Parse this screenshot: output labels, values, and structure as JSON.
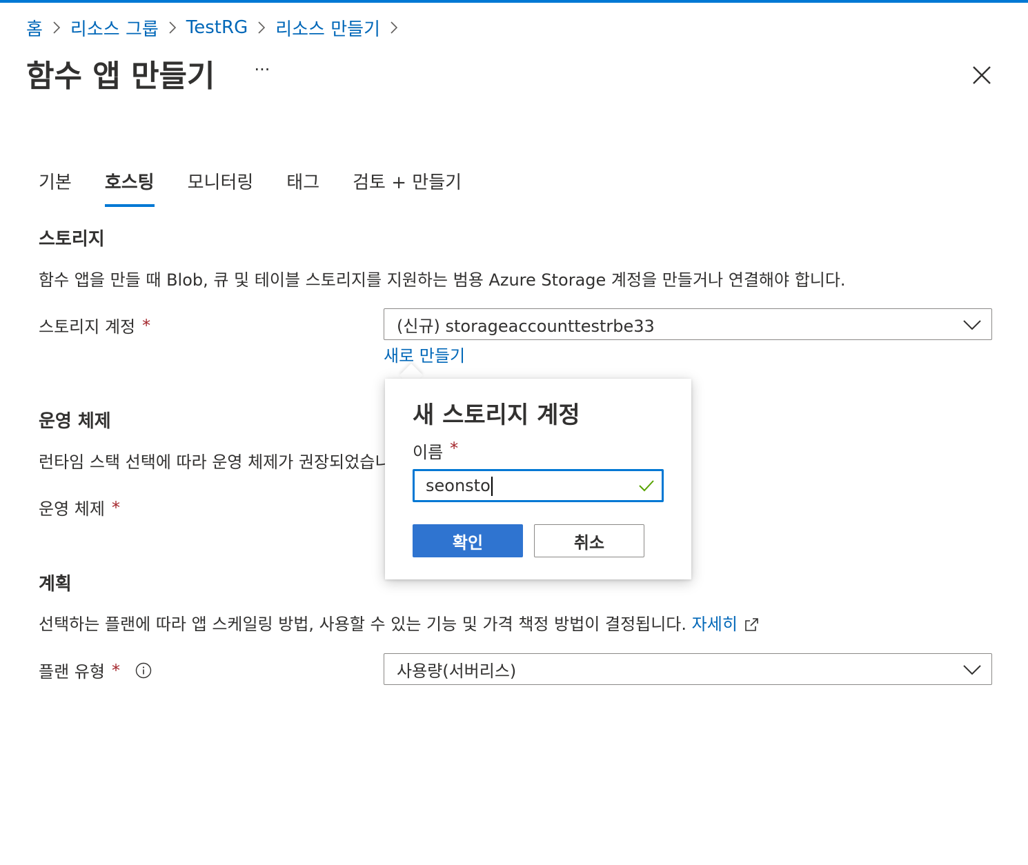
{
  "breadcrumb": {
    "items": [
      "홈",
      "리소스 그룹",
      "TestRG",
      "리소스 만들기"
    ]
  },
  "header": {
    "title": "함수 앱 만들기",
    "more_label": "···"
  },
  "tabs": [
    {
      "label": "기본",
      "active": false
    },
    {
      "label": "호스팅",
      "active": true
    },
    {
      "label": "모니터링",
      "active": false
    },
    {
      "label": "태그",
      "active": false
    },
    {
      "label": "검토 + 만들기",
      "active": false
    }
  ],
  "storage": {
    "title": "스토리지",
    "description": "함수 앱을 만들 때 Blob, 큐 및 테이블 스토리지를 지원하는 범용 Azure Storage 계정을 만들거나 연결해야 합니다.",
    "account_label": "스토리지 계정",
    "account_value": "(신규) storageaccounttestrbe33",
    "create_new_link": "새로 만들기"
  },
  "os": {
    "title": "운영 체제",
    "description": "런타임 스택 선택에 따라 운영 체제가 권장되었습니",
    "label": "운영 체제"
  },
  "plan": {
    "title": "계획",
    "description": "선택하는 플랜에 따라 앱 스케일링 방법, 사용할 수 있는 기능 및 가격 책정 방법이 결정됩니다.",
    "learn_more": "자세히",
    "type_label": "플랜 유형",
    "type_value": "사용량(서버리스)"
  },
  "required_mark": "*",
  "popup": {
    "title": "새 스토리지 계정",
    "name_label": "이름",
    "name_value": "seonsto",
    "ok_label": "확인",
    "cancel_label": "취소"
  },
  "colors": {
    "accent": "#0078d4",
    "link": "#0067b8",
    "required": "#a4262c",
    "valid": "#57a300",
    "primary_button": "#2f74d0"
  },
  "icons": [
    "chevron-right-icon",
    "close-icon",
    "chevron-down-icon",
    "info-icon",
    "external-link-icon",
    "checkmark-icon"
  ]
}
